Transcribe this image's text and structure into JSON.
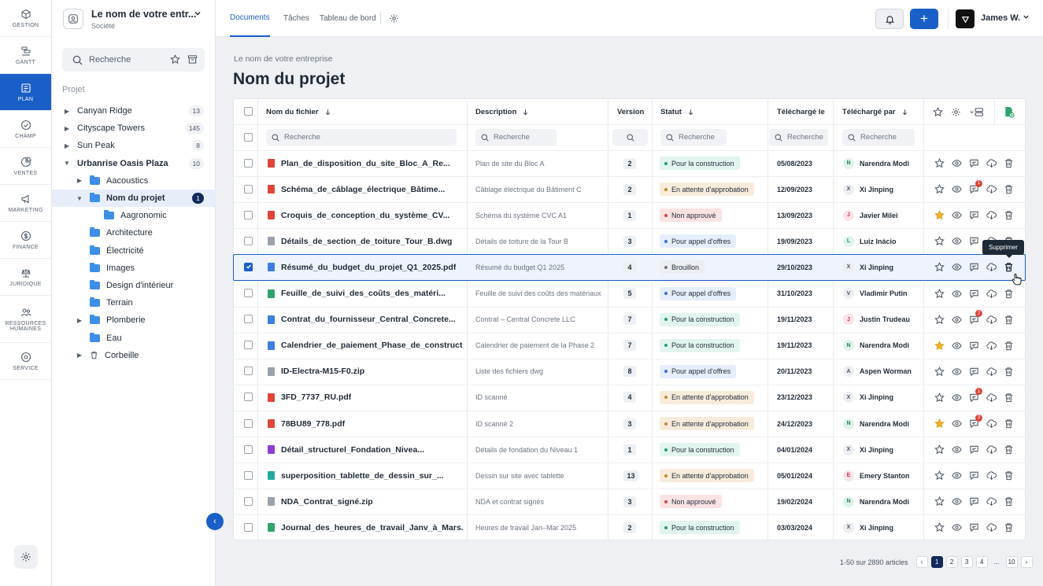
{
  "rail": [
    {
      "label": "GESTION",
      "icon": "cube-icon"
    },
    {
      "label": "GANTT",
      "icon": "gantt-icon"
    },
    {
      "label": "PLAN",
      "icon": "plan-icon",
      "active": true
    },
    {
      "label": "CHAMP",
      "icon": "check-circle-icon"
    },
    {
      "label": "VENTES",
      "icon": "pie-icon"
    },
    {
      "label": "MARKETING",
      "icon": "megaphone-icon"
    },
    {
      "label": "FINANCE",
      "icon": "dollar-icon"
    },
    {
      "label": "JURIDIQUE",
      "icon": "scale-icon"
    },
    {
      "label": "RESSOURCES HUMAINES",
      "icon": "people-icon"
    },
    {
      "label": "SERVICE",
      "icon": "service-icon"
    }
  ],
  "company": {
    "name": "Le nom de votre entr...",
    "sub": "Société"
  },
  "side_search": {
    "placeholder": "Recherche"
  },
  "project_label": "Projet",
  "tree": [
    {
      "label": "Canyan Ridge",
      "level": 0,
      "caret": "right",
      "count": "13"
    },
    {
      "label": "Cityscape Towers",
      "level": 0,
      "caret": "right",
      "count": "145"
    },
    {
      "label": "Sun Peak",
      "level": 0,
      "caret": "right",
      "count": "8"
    },
    {
      "label": "Urbanrise Oasis Plaza",
      "level": 0,
      "caret": "down",
      "count": "10",
      "bold": true
    },
    {
      "label": "Aacoustics",
      "level": 1,
      "caret": "right",
      "folder": true
    },
    {
      "label": "Nom du projet",
      "level": 1,
      "caret": "down",
      "folder": true,
      "count": "1",
      "selected": true
    },
    {
      "label": "Aagronomic",
      "level": 2,
      "folder": true
    },
    {
      "label": "Architecture",
      "level": 1,
      "folder": true
    },
    {
      "label": "Électricité",
      "level": 1,
      "folder": true
    },
    {
      "label": "Images",
      "level": 1,
      "folder": true
    },
    {
      "label": "Design d'intérieur",
      "level": 1,
      "folder": true
    },
    {
      "label": "Terrain",
      "level": 1,
      "folder": true
    },
    {
      "label": "Plomberie",
      "level": 1,
      "caret": "right",
      "folder": true
    },
    {
      "label": "Eau",
      "level": 1,
      "folder": true
    },
    {
      "label": "Corbeille",
      "level": 1,
      "caret": "right",
      "trash": true
    }
  ],
  "tabs": [
    "Documents",
    "Tâches",
    "Tableau de bord"
  ],
  "user": {
    "name": "James W."
  },
  "breadcrumb": "Le nom de votre entreprise",
  "title": "Nom du projet",
  "columns": {
    "name": "Nom du fichier",
    "desc": "Description",
    "version": "Version",
    "status": "Statut",
    "uploaded_on": "Téléchargé le",
    "uploaded_by": "Téléchargé par"
  },
  "filter_placeholder": "Recherche",
  "rows": [
    {
      "name": "Plan_de_disposition_du_site_Bloc_A_Re...",
      "type": "pdf",
      "desc": "Plan de site du Bloc A",
      "version": "2",
      "status": "Pour la construction",
      "date": "05/08/2023",
      "user": "Narendra Modi",
      "initial": "N",
      "star": false,
      "badge": ""
    },
    {
      "name": "Schéma_de_câblage_électrique_Bâtime...",
      "type": "pdf",
      "desc": "Câblage électrique du Bâtiment C",
      "version": "2",
      "status": "En attente d'approbation",
      "date": "12/09/2023",
      "user": "Xi Jinping",
      "initial": "X",
      "star": false,
      "badge": "1"
    },
    {
      "name": "Croquis_de_conception_du_système_CV...",
      "type": "pdf",
      "desc": "Schéma du système CVC A1",
      "version": "1",
      "status": "Non approuvé",
      "date": "13/09/2023",
      "user": "Javier Milei",
      "initial": "J",
      "star": true,
      "badge": ""
    },
    {
      "name": "Détails_de_section_de_toiture_Tour_B.dwg",
      "type": "dwg",
      "desc": "Détails de toiture de la Tour B",
      "version": "3",
      "status": "Pour appel d'offres",
      "date": "19/09/2023",
      "user": "Luiz Inácio",
      "initial": "L",
      "star": false,
      "badge": ""
    },
    {
      "name": "Résumé_du_budget_du_projet_Q1_2025.pdf",
      "type": "doc",
      "desc": "Résumé du budget Q1 2025",
      "version": "4",
      "status": "Brouillon",
      "date": "29/10/2023",
      "user": "Xi Jinping",
      "initial": "X",
      "star": false,
      "badge": "",
      "selected": true
    },
    {
      "name": "Feuille_de_suivi_des_coûts_des_matéri...",
      "type": "xls",
      "desc": "Feuille de suivi des coûts des matériaux",
      "version": "5",
      "status": "Pour appel d'offres",
      "date": "31/10/2023",
      "user": "Vladimir Putin",
      "initial": "V",
      "star": false,
      "badge": ""
    },
    {
      "name": "Contrat_du_fournisseur_Central_Concrete...",
      "type": "doc",
      "desc": "Contrat – Central Concrete LLC",
      "version": "7",
      "status": "Pour la construction",
      "date": "19/11/2023",
      "user": "Justin Trudeau",
      "initial": "J",
      "star": false,
      "badge": "2"
    },
    {
      "name": "Calendrier_de_paiement_Phase_de_construct...",
      "type": "doc",
      "desc": "Calendrier de paiement de la Phase 2",
      "version": "7",
      "status": "Pour la construction",
      "date": "19/11/2023",
      "user": "Narendra Modi",
      "initial": "N",
      "star": true,
      "badge": ""
    },
    {
      "name": "ID-Electra-M15-F0.zip",
      "type": "zip",
      "desc": "Liste des fichiers dwg",
      "version": "8",
      "status": "Pour appel d'offres",
      "date": "20/11/2023",
      "user": "Aspen Worman",
      "initial": "A",
      "star": false,
      "badge": ""
    },
    {
      "name": "3FD_7737_RU.pdf",
      "type": "pdf",
      "desc": "ID scanné",
      "version": "4",
      "status": "En attente d'approbation",
      "date": "23/12/2023",
      "user": "Xi Jinping",
      "initial": "X",
      "star": false,
      "badge": "1"
    },
    {
      "name": "78BU89_778.pdf",
      "type": "pdf",
      "desc": "ID scanné 2",
      "version": "3",
      "status": "En attente d'approbation",
      "date": "24/12/2023",
      "user": "Narendra Modi",
      "initial": "N",
      "star": true,
      "badge": "3"
    },
    {
      "name": "Détail_structurel_Fondation_Nivea...",
      "type": "purple",
      "desc": "Détails de fondation du Niveau 1",
      "version": "1",
      "status": "Pour la construction",
      "date": "04/01/2024",
      "user": "Xi Jinping",
      "initial": "X",
      "star": false,
      "badge": ""
    },
    {
      "name": "superposition_tablette_de_dessin_sur_...",
      "type": "teal",
      "desc": "Dessin sur site avec tablette",
      "version": "13",
      "status": "En attente d'approbation",
      "date": "05/01/2024",
      "user": "Emery Stanton",
      "initial": "E",
      "star": false,
      "badge": ""
    },
    {
      "name": "NDA_Contrat_signé.zip",
      "type": "zip",
      "desc": "NDA et contrat signés",
      "version": "3",
      "status": "Non approuvé",
      "date": "19/02/2024",
      "user": "Narendra Modi",
      "initial": "N",
      "star": false,
      "badge": ""
    },
    {
      "name": "Journal_des_heures_de_travail_Janv_à_Mars...",
      "type": "xls",
      "desc": "Heures de travail Jan–Mar 2025",
      "version": "2",
      "status": "Pour la construction",
      "date": "03/03/2024",
      "user": "Xi Jinping",
      "initial": "X",
      "star": false,
      "badge": ""
    }
  ],
  "tooltip": "Supprimer",
  "pagination": {
    "summary": "1-50 sur 2890 articles",
    "pages": [
      "1",
      "2",
      "3",
      "4",
      "...",
      "10"
    ]
  },
  "colors": {
    "accent": "#1a5fc7",
    "navy": "#12295b"
  }
}
